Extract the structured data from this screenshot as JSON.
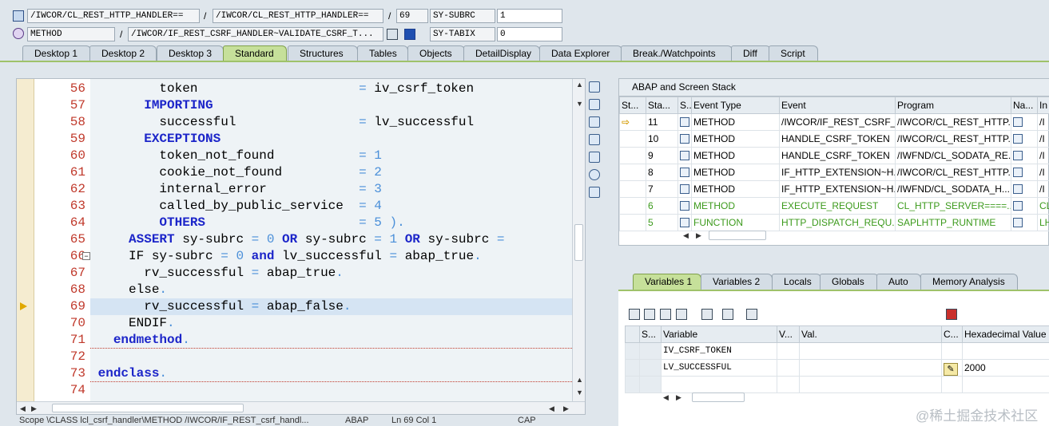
{
  "header": {
    "row1": {
      "field1": "/IWCOR/CL_REST_HTTP_HANDLER==",
      "sep1": "/",
      "field2": "/IWCOR/CL_REST_HTTP_HANDLER==",
      "sep2": "/",
      "line": "69",
      "sysname": "SY-SUBRC",
      "sysvalue": "1"
    },
    "row2": {
      "type": "METHOD",
      "sep": "/",
      "method": "/IWCOR/IF_REST_CSRF_HANDLER~VALIDATE_CSRF_T...",
      "sysname": "SY-TABIX",
      "sysvalue": "0"
    }
  },
  "tabs": [
    "Desktop 1",
    "Desktop 2",
    "Desktop 3",
    "Standard",
    "Structures",
    "Tables",
    "Objects",
    "DetailDisplay",
    "Data Explorer",
    "Break./Watchpoints",
    "Diff",
    "Script"
  ],
  "active_tab": "Standard",
  "editor": {
    "lines": [
      {
        "n": "56",
        "indent": "    ",
        "parts": [
          [
            "id",
            "token"
          ],
          [
            "id",
            "                     "
          ],
          [
            "op",
            "="
          ],
          [
            "id",
            " iv_csrf_token"
          ]
        ]
      },
      {
        "n": "57",
        "indent": "   ",
        "parts": [
          [
            "kw",
            "IMPORTING"
          ]
        ]
      },
      {
        "n": "58",
        "indent": "    ",
        "parts": [
          [
            "id",
            "successful"
          ],
          [
            "id",
            "                "
          ],
          [
            "op",
            "="
          ],
          [
            "id",
            " lv_successful"
          ]
        ]
      },
      {
        "n": "59",
        "indent": "   ",
        "parts": [
          [
            "kw",
            "EXCEPTIONS"
          ]
        ]
      },
      {
        "n": "60",
        "indent": "    ",
        "parts": [
          [
            "id",
            "token_not_found"
          ],
          [
            "id",
            "           "
          ],
          [
            "op",
            "="
          ],
          [
            "num",
            " 1"
          ]
        ]
      },
      {
        "n": "61",
        "indent": "    ",
        "parts": [
          [
            "id",
            "cookie_not_found"
          ],
          [
            "id",
            "          "
          ],
          [
            "op",
            "="
          ],
          [
            "num",
            " 2"
          ]
        ]
      },
      {
        "n": "62",
        "indent": "    ",
        "parts": [
          [
            "id",
            "internal_error"
          ],
          [
            "id",
            "            "
          ],
          [
            "op",
            "="
          ],
          [
            "num",
            " 3"
          ]
        ]
      },
      {
        "n": "63",
        "indent": "    ",
        "parts": [
          [
            "id",
            "called_by_public_service"
          ],
          [
            "id",
            "  "
          ],
          [
            "op",
            "="
          ],
          [
            "num",
            " 4"
          ]
        ]
      },
      {
        "n": "64",
        "indent": "    ",
        "parts": [
          [
            "kw",
            "OTHERS"
          ],
          [
            "id",
            "                    "
          ],
          [
            "op",
            "="
          ],
          [
            "num",
            " 5"
          ],
          [
            "op",
            " )."
          ]
        ]
      },
      {
        "n": "65",
        "indent": "  ",
        "parts": [
          [
            "kw",
            "ASSERT"
          ],
          [
            "id",
            " sy-subrc "
          ],
          [
            "op",
            "="
          ],
          [
            "num",
            " 0"
          ],
          [
            "kw",
            " OR"
          ],
          [
            "id",
            " sy-subrc "
          ],
          [
            "op",
            "="
          ],
          [
            "num",
            " 1"
          ],
          [
            "kw",
            " OR"
          ],
          [
            "id",
            " sy-subrc "
          ],
          [
            "op",
            "="
          ]
        ]
      },
      {
        "n": "66",
        "indent": "  ",
        "parts": [
          [
            "lblk",
            "IF"
          ],
          [
            "id",
            " sy-subrc "
          ],
          [
            "op",
            "="
          ],
          [
            "num",
            " 0"
          ],
          [
            "kw",
            " and"
          ],
          [
            "id",
            " lv_successful "
          ],
          [
            "op",
            "="
          ],
          [
            "id",
            " abap_true"
          ],
          [
            "op",
            "."
          ]
        ]
      },
      {
        "n": "67",
        "indent": "   ",
        "parts": [
          [
            "id",
            "rv_successful "
          ],
          [
            "op",
            "="
          ],
          [
            "id",
            " abap_true"
          ],
          [
            "op",
            "."
          ]
        ]
      },
      {
        "n": "68",
        "indent": "  ",
        "parts": [
          [
            "lblk",
            "else"
          ],
          [
            "op",
            "."
          ]
        ]
      },
      {
        "n": "69",
        "indent": "   ",
        "parts": [
          [
            "id",
            "rv_successful "
          ],
          [
            "op",
            "="
          ],
          [
            "id",
            " abap_false"
          ],
          [
            "op",
            "."
          ]
        ]
      },
      {
        "n": "70",
        "indent": "  ",
        "parts": [
          [
            "lblk",
            "ENDIF"
          ],
          [
            "op",
            "."
          ]
        ]
      },
      {
        "n": "71",
        "indent": " ",
        "parts": [
          [
            "kw",
            "endmethod"
          ],
          [
            "op",
            "."
          ]
        ]
      },
      {
        "n": "72",
        "indent": "",
        "parts": []
      },
      {
        "n": "73",
        "indent": "",
        "parts": [
          [
            "kw",
            "endclass"
          ],
          [
            "op",
            "."
          ]
        ]
      },
      {
        "n": "74",
        "indent": "",
        "parts": []
      }
    ],
    "current_line": "69"
  },
  "status": {
    "scope": "Scope \\CLASS lcl_csrf_handler\\METHOD /IWCOR/IF_REST_csrf_handl...",
    "lang": "ABAP",
    "pos": "Ln  69 Col   1",
    "caps": "CAP"
  },
  "stack": {
    "title": "ABAP and Screen Stack",
    "columns": [
      "St...",
      "Sta...",
      "S...",
      "Event Type",
      "Event",
      "Program",
      "Na...",
      "In"
    ],
    "rows": [
      {
        "arrow": true,
        "level": "11",
        "type": "METHOD",
        "event": "/IWCOR/IF_REST_CSRF_...",
        "program": "/IWCOR/CL_REST_HTTP...",
        "inc": "/I",
        "green": false
      },
      {
        "arrow": false,
        "level": "10",
        "type": "METHOD",
        "event": "HANDLE_CSRF_TOKEN",
        "program": "/IWCOR/CL_REST_HTTP...",
        "inc": "/I",
        "green": false
      },
      {
        "arrow": false,
        "level": "9",
        "type": "METHOD",
        "event": "HANDLE_CSRF_TOKEN",
        "program": "/IWFND/CL_SODATA_RE...",
        "inc": "/I",
        "green": false
      },
      {
        "arrow": false,
        "level": "8",
        "type": "METHOD",
        "event": "IF_HTTP_EXTENSION~H...",
        "program": "/IWCOR/CL_REST_HTTP...",
        "inc": "/I",
        "green": false
      },
      {
        "arrow": false,
        "level": "7",
        "type": "METHOD",
        "event": "IF_HTTP_EXTENSION~H...",
        "program": "/IWFND/CL_SODATA_H...",
        "inc": "/I",
        "green": false
      },
      {
        "arrow": false,
        "level": "6",
        "type": "METHOD",
        "event": "EXECUTE_REQUEST",
        "program": "CL_HTTP_SERVER====...",
        "inc": "CL",
        "green": true
      },
      {
        "arrow": false,
        "level": "5",
        "type": "FUNCTION",
        "event": "HTTP_DISPATCH_REQU...",
        "program": "SAPLHTTP_RUNTIME",
        "inc": "LH",
        "green": true
      }
    ]
  },
  "variables": {
    "tabs": [
      "Variables 1",
      "Variables 2",
      "Locals",
      "Globals",
      "Auto",
      "Memory Analysis"
    ],
    "active_tab": "Variables 1",
    "columns": [
      "S...",
      "Variable",
      "V...",
      "Val.",
      "C...",
      "Hexadecimal Value"
    ],
    "rows": [
      {
        "name": "IV_CSRF_TOKEN",
        "value": "",
        "hex": "",
        "edit": false
      },
      {
        "name": "LV_SUCCESSFUL",
        "value": "",
        "hex": "2000",
        "edit": true
      },
      {
        "name": "",
        "value": "",
        "hex": "",
        "edit": false
      }
    ]
  },
  "watermark": "@稀土掘金技术社区",
  "colors": {
    "keyword": "#1c25c9",
    "number": "#4a8fd9",
    "linenum": "#c0392b",
    "active_tab": "#c6e09a",
    "green_row": "#3c9a1c"
  }
}
